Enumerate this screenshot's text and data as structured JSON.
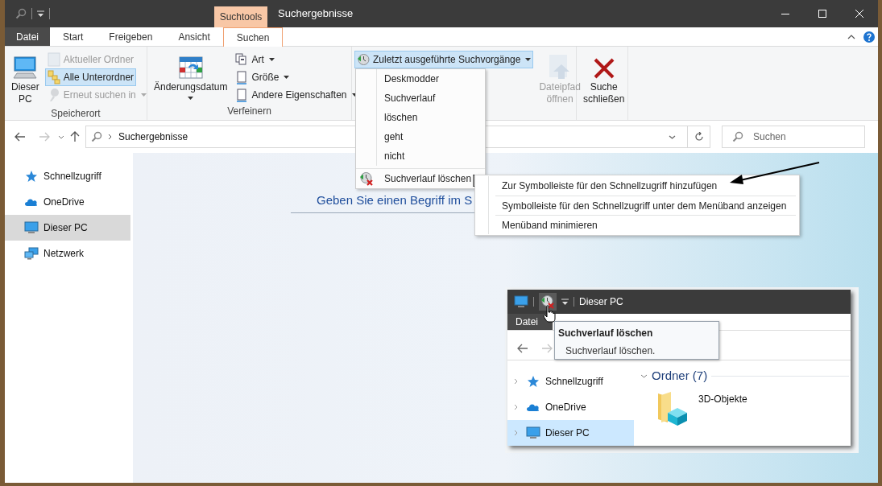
{
  "title_bar": {
    "context_tab": "Suchtools",
    "title": "Suchergebnisse"
  },
  "ribbon": {
    "tabs": [
      {
        "label": "Datei",
        "kind": "file",
        "selected": false
      },
      {
        "label": "Start",
        "kind": "tab",
        "selected": false
      },
      {
        "label": "Freigeben",
        "kind": "tab",
        "selected": false
      },
      {
        "label": "Ansicht",
        "kind": "tab",
        "selected": false
      },
      {
        "label": "Suchen",
        "kind": "tab",
        "selected": true
      }
    ],
    "groups": [
      {
        "label": "Speicherort",
        "buttons": [
          {
            "label": "Dieser PC",
            "kind": "large",
            "disabled": false,
            "selected": false,
            "dropdown": false
          },
          {
            "label": "Aktueller Ordner",
            "kind": "small",
            "disabled": true,
            "selected": false,
            "dropdown": false
          },
          {
            "label": "Alle Unterordner",
            "kind": "small",
            "disabled": false,
            "selected": true,
            "dropdown": false
          },
          {
            "label": "Erneut suchen in",
            "kind": "small",
            "disabled": true,
            "selected": false,
            "dropdown": true
          }
        ]
      },
      {
        "label": "Verfeinern",
        "buttons": [
          {
            "label": "Änderungsdatum",
            "kind": "large",
            "disabled": false,
            "selected": false,
            "dropdown": true
          },
          {
            "label": "Art",
            "kind": "small",
            "disabled": false,
            "selected": false,
            "dropdown": true
          },
          {
            "label": "Größe",
            "kind": "small",
            "disabled": false,
            "selected": false,
            "dropdown": true
          },
          {
            "label": "Andere Eigenschaften",
            "kind": "small",
            "disabled": false,
            "selected": false,
            "dropdown": true
          }
        ]
      },
      {
        "buttons": [
          {
            "label": "Zuletzt ausgeführte Suchvorgänge",
            "kind": "small",
            "disabled": false,
            "selected": true,
            "dropdown": true
          },
          {
            "label": "Dateipfad öffnen",
            "kind": "large",
            "disabled": true,
            "selected": false,
            "dropdown": false
          }
        ]
      },
      {
        "buttons": [
          {
            "label": "Suche schließen",
            "kind": "large",
            "disabled": false,
            "selected": false,
            "dropdown": false
          }
        ]
      }
    ]
  },
  "address_bar": {
    "path": "Suchergebnisse",
    "search_placeholder": "Suchen"
  },
  "nav_pane": [
    {
      "label": "Schnellzugriff",
      "selected": false
    },
    {
      "label": "OneDrive",
      "selected": false
    },
    {
      "label": "Dieser PC",
      "selected": true
    },
    {
      "label": "Netzwerk",
      "selected": false
    }
  ],
  "content": {
    "hint": "Geben Sie einen Begriff im S"
  },
  "recent_searches_menu": {
    "items": [
      "Deskmodder",
      "Suchverlauf",
      "löschen",
      "geht",
      "nicht"
    ],
    "footer": "Suchverlauf löschen"
  },
  "context_menu": {
    "items": [
      "Zur Symbolleiste für den Schnellzugriff hinzufügen",
      "Symbolleiste für den Schnellzugriff unter dem Menüband anzeigen",
      "Menüband minimieren"
    ]
  },
  "inset": {
    "title": "Dieser PC",
    "tab": "Datei",
    "tooltip": {
      "title": "Suchverlauf löschen",
      "text": "Suchverlauf löschen."
    },
    "nav": [
      {
        "label": "Schnellzugriff",
        "selected": false
      },
      {
        "label": "OneDrive",
        "selected": false
      },
      {
        "label": "Dieser PC",
        "selected": true
      }
    ],
    "group": {
      "label": "Ordner (7)",
      "items": [
        "3D-Objekte"
      ]
    }
  }
}
